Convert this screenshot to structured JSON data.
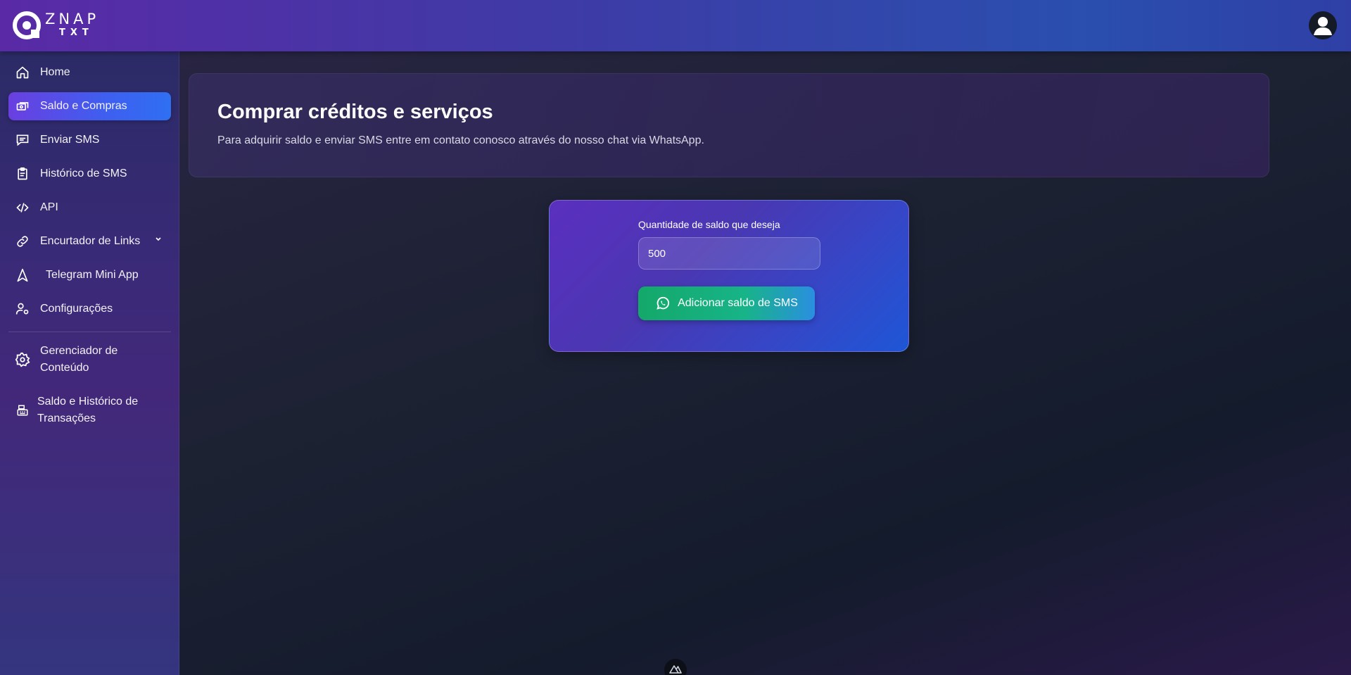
{
  "brand": {
    "top": "ZNAP",
    "bottom": "TXT"
  },
  "sidebar": {
    "items": [
      {
        "label": "Home",
        "icon": "home-icon"
      },
      {
        "label": "Saldo e Compras",
        "icon": "cash-icon",
        "active": true
      },
      {
        "label": "Enviar SMS",
        "icon": "message-icon"
      },
      {
        "label": "Histórico de SMS",
        "icon": "clipboard-icon"
      },
      {
        "label": "API",
        "icon": "code-icon"
      },
      {
        "label": "Encurtador de Links",
        "icon": "link-icon",
        "has_submenu": true
      },
      {
        "label": "Telegram Mini App",
        "icon": "navigation-icon"
      },
      {
        "label": "Configurações",
        "icon": "user-settings-icon"
      },
      {
        "label": "Gerenciador de Conteúdo",
        "icon": "gear-icon"
      },
      {
        "label": "Saldo e Histórico de Transações",
        "icon": "cash-register-icon"
      }
    ]
  },
  "header": {
    "title": "Comprar créditos e serviços",
    "subtitle": "Para adquirir saldo e enviar SMS entre em contato conosco através do nosso chat via WhatsApp."
  },
  "purchase": {
    "label": "Quantidade de saldo que deseja",
    "value": "500",
    "button_label": "Adicionar saldo de SMS",
    "button_icon": "whatsapp-icon"
  },
  "colors": {
    "active_nav": "#4f4fe8",
    "button_green": "#17b07a",
    "card_purple": "#5b2fc0",
    "card_blue": "#1e56d6"
  }
}
